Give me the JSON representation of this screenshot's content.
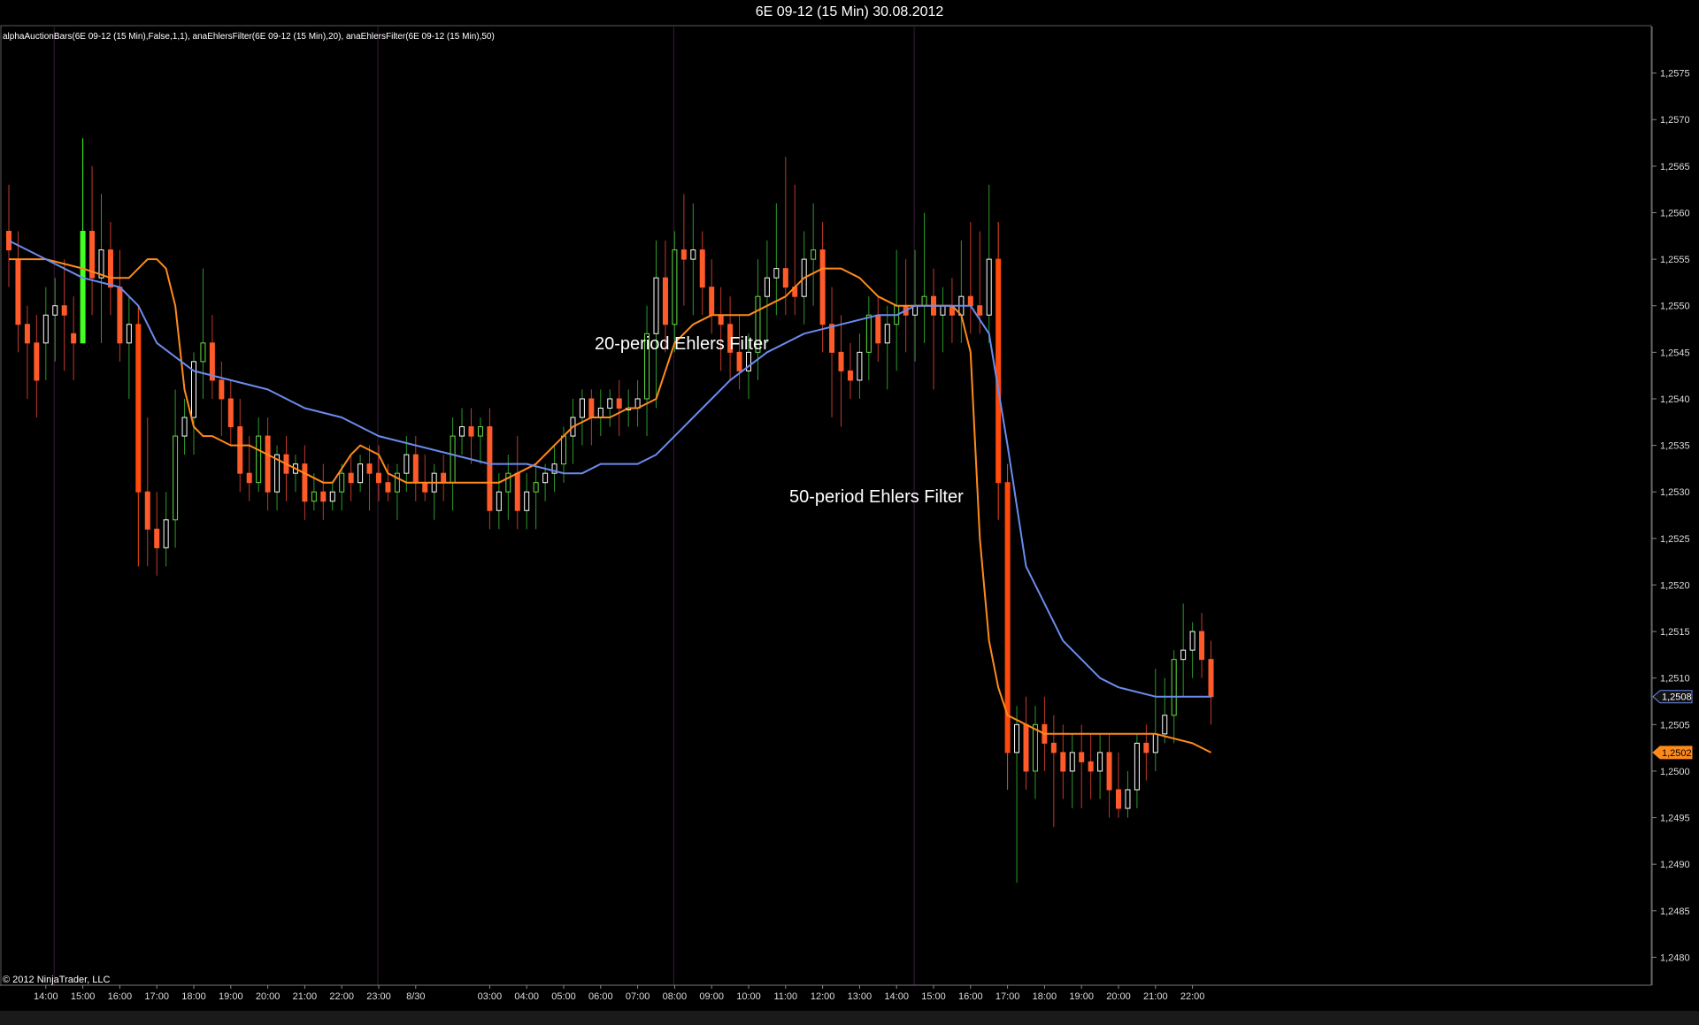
{
  "window": {
    "title": "6E 09-12 (15 Min)  30.08.2012"
  },
  "chart_data": {
    "type": "candlestick",
    "instrument": "6E 09-12 (15 Min)",
    "date": "30.08.2012",
    "indicator_text": "alphaAuctionBars(6E 09-12 (15 Min),False,1,1), anaEhlersFilter(6E 09-12 (15 Min),20), anaEhlersFilter(6E 09-12 (15 Min),50)",
    "copyright": "© 2012 NinjaTrader, LLC",
    "ylim": [
      1.2477,
      1.258
    ],
    "y_ticks": [
      "1,2480",
      "1,2485",
      "1,2490",
      "1,2495",
      "1,2500",
      "1,2505",
      "1,2510",
      "1,2515",
      "1,2520",
      "1,2525",
      "1,2530",
      "1,2535",
      "1,2540",
      "1,2545",
      "1,2550",
      "1,2555",
      "1,2560",
      "1,2565",
      "1,2570",
      "1,2575"
    ],
    "y_tick_values": [
      1.248,
      1.2485,
      1.249,
      1.2495,
      1.25,
      1.2505,
      1.251,
      1.2515,
      1.252,
      1.2525,
      1.253,
      1.2535,
      1.254,
      1.2545,
      1.255,
      1.2555,
      1.256,
      1.2565,
      1.257,
      1.2575
    ],
    "x_labels": [
      {
        "label": "14:00",
        "bar": 4
      },
      {
        "label": "15:00",
        "bar": 8
      },
      {
        "label": "16:00",
        "bar": 12
      },
      {
        "label": "17:00",
        "bar": 16
      },
      {
        "label": "18:00",
        "bar": 20
      },
      {
        "label": "19:00",
        "bar": 24
      },
      {
        "label": "20:00",
        "bar": 28
      },
      {
        "label": "21:00",
        "bar": 32
      },
      {
        "label": "22:00",
        "bar": 36
      },
      {
        "label": "23:00",
        "bar": 40
      },
      {
        "label": "8/30",
        "bar": 44
      },
      {
        "label": "03:00",
        "bar": 52
      },
      {
        "label": "04:00",
        "bar": 56
      },
      {
        "label": "05:00",
        "bar": 60
      },
      {
        "label": "06:00",
        "bar": 64
      },
      {
        "label": "07:00",
        "bar": 68
      },
      {
        "label": "08:00",
        "bar": 72
      },
      {
        "label": "09:00",
        "bar": 76
      },
      {
        "label": "10:00",
        "bar": 80
      },
      {
        "label": "11:00",
        "bar": 84
      },
      {
        "label": "12:00",
        "bar": 88
      },
      {
        "label": "13:00",
        "bar": 92
      },
      {
        "label": "14:00",
        "bar": 96
      },
      {
        "label": "15:00",
        "bar": 100
      },
      {
        "label": "16:00",
        "bar": 104
      },
      {
        "label": "17:00",
        "bar": 108
      },
      {
        "label": "18:00",
        "bar": 112
      },
      {
        "label": "19:00",
        "bar": 116
      },
      {
        "label": "20:00",
        "bar": 120
      },
      {
        "label": "21:00",
        "bar": 124
      },
      {
        "label": "22:00",
        "bar": 128
      }
    ],
    "session_breaks": [
      5,
      40,
      72,
      98
    ],
    "candles_ohlc": [
      [
        1.2558,
        1.2563,
        1.2552,
        1.2556
      ],
      [
        1.2555,
        1.2558,
        1.2545,
        1.2548
      ],
      [
        1.2548,
        1.255,
        1.254,
        1.2546
      ],
      [
        1.2546,
        1.2549,
        1.2538,
        1.2542
      ],
      [
        1.2546,
        1.2552,
        1.2542,
        1.2549
      ],
      [
        1.2549,
        1.2553,
        1.2544,
        1.255
      ],
      [
        1.255,
        1.2555,
        1.2543,
        1.2549
      ],
      [
        1.2547,
        1.2551,
        1.2542,
        1.2546
      ],
      [
        1.2546,
        1.2568,
        1.2546,
        1.2558
      ],
      [
        1.2558,
        1.2565,
        1.2549,
        1.2553
      ],
      [
        1.2553,
        1.2562,
        1.2546,
        1.2556
      ],
      [
        1.2556,
        1.2559,
        1.2549,
        1.2552
      ],
      [
        1.2552,
        1.2556,
        1.2544,
        1.2546
      ],
      [
        1.2546,
        1.2551,
        1.254,
        1.2548
      ],
      [
        1.2548,
        1.255,
        1.2522,
        1.253
      ],
      [
        1.253,
        1.2538,
        1.2522,
        1.2526
      ],
      [
        1.2526,
        1.253,
        1.2521,
        1.2524
      ],
      [
        1.2524,
        1.253,
        1.2522,
        1.2527
      ],
      [
        1.2527,
        1.2541,
        1.2524,
        1.2536
      ],
      [
        1.2536,
        1.254,
        1.2534,
        1.2538
      ],
      [
        1.2538,
        1.2545,
        1.2534,
        1.2544
      ],
      [
        1.2544,
        1.2554,
        1.254,
        1.2546
      ],
      [
        1.2546,
        1.2549,
        1.254,
        1.2542
      ],
      [
        1.2542,
        1.2544,
        1.2536,
        1.254
      ],
      [
        1.254,
        1.2542,
        1.2535,
        1.2537
      ],
      [
        1.2537,
        1.254,
        1.253,
        1.2532
      ],
      [
        1.2532,
        1.2536,
        1.2529,
        1.2531
      ],
      [
        1.2531,
        1.2538,
        1.253,
        1.2536
      ],
      [
        1.2536,
        1.2538,
        1.2528,
        1.253
      ],
      [
        1.253,
        1.2535,
        1.2528,
        1.2534
      ],
      [
        1.2534,
        1.2536,
        1.2529,
        1.2532
      ],
      [
        1.2532,
        1.2534,
        1.253,
        1.2533
      ],
      [
        1.2533,
        1.2535,
        1.2527,
        1.2529
      ],
      [
        1.2529,
        1.2532,
        1.2528,
        1.253
      ],
      [
        1.253,
        1.2533,
        1.2527,
        1.2529
      ],
      [
        1.2529,
        1.2531,
        1.2528,
        1.253
      ],
      [
        1.253,
        1.2533,
        1.2528,
        1.2532
      ],
      [
        1.2532,
        1.2534,
        1.2529,
        1.2531
      ],
      [
        1.2531,
        1.2534,
        1.253,
        1.2533
      ],
      [
        1.2533,
        1.2535,
        1.2528,
        1.2532
      ],
      [
        1.2532,
        1.2535,
        1.2529,
        1.2531
      ],
      [
        1.2531,
        1.2533,
        1.2529,
        1.253
      ],
      [
        1.253,
        1.2533,
        1.2527,
        1.2532
      ],
      [
        1.2532,
        1.2536,
        1.253,
        1.2534
      ],
      [
        1.2534,
        1.2536,
        1.2529,
        1.2531
      ],
      [
        1.2531,
        1.2534,
        1.2529,
        1.253
      ],
      [
        1.253,
        1.2533,
        1.2527,
        1.2532
      ],
      [
        1.2532,
        1.2534,
        1.2529,
        1.2531
      ],
      [
        1.2531,
        1.2538,
        1.2528,
        1.2536
      ],
      [
        1.2536,
        1.2539,
        1.2534,
        1.2537
      ],
      [
        1.2537,
        1.2539,
        1.2533,
        1.2536
      ],
      [
        1.2536,
        1.2538,
        1.2533,
        1.2537
      ],
      [
        1.2537,
        1.2539,
        1.2526,
        1.2528
      ],
      [
        1.2528,
        1.2532,
        1.2526,
        1.253
      ],
      [
        1.253,
        1.2534,
        1.2527,
        1.2532
      ],
      [
        1.2532,
        1.2536,
        1.2526,
        1.2528
      ],
      [
        1.2528,
        1.2532,
        1.2526,
        1.253
      ],
      [
        1.253,
        1.2533,
        1.2526,
        1.2531
      ],
      [
        1.2531,
        1.2533,
        1.2529,
        1.2532
      ],
      [
        1.2532,
        1.2535,
        1.253,
        1.2533
      ],
      [
        1.2533,
        1.2537,
        1.2531,
        1.2536
      ],
      [
        1.2536,
        1.254,
        1.2533,
        1.2538
      ],
      [
        1.2538,
        1.2541,
        1.2535,
        1.254
      ],
      [
        1.254,
        1.2541,
        1.2535,
        1.2538
      ],
      [
        1.2538,
        1.2541,
        1.2536,
        1.2539
      ],
      [
        1.2539,
        1.2541,
        1.2537,
        1.254
      ],
      [
        1.254,
        1.2542,
        1.2536,
        1.2539
      ],
      [
        1.2539,
        1.2541,
        1.2537,
        1.2539
      ],
      [
        1.2539,
        1.2542,
        1.2537,
        1.254
      ],
      [
        1.254,
        1.255,
        1.2536,
        1.2547
      ],
      [
        1.2547,
        1.2557,
        1.2539,
        1.2553
      ],
      [
        1.2553,
        1.2557,
        1.2545,
        1.2548
      ],
      [
        1.2548,
        1.2558,
        1.2545,
        1.2556
      ],
      [
        1.2556,
        1.2562,
        1.255,
        1.2555
      ],
      [
        1.2555,
        1.2561,
        1.2549,
        1.2556
      ],
      [
        1.2556,
        1.2558,
        1.2549,
        1.2552
      ],
      [
        1.2552,
        1.2555,
        1.2547,
        1.2549
      ],
      [
        1.2549,
        1.2552,
        1.2543,
        1.2548
      ],
      [
        1.2548,
        1.2551,
        1.2542,
        1.2545
      ],
      [
        1.2545,
        1.2549,
        1.2541,
        1.2543
      ],
      [
        1.2543,
        1.2547,
        1.254,
        1.2545
      ],
      [
        1.2545,
        1.2555,
        1.2542,
        1.2551
      ],
      [
        1.2551,
        1.2557,
        1.2546,
        1.2553
      ],
      [
        1.2553,
        1.2561,
        1.2549,
        1.2554
      ],
      [
        1.2554,
        1.2566,
        1.2549,
        1.2552
      ],
      [
        1.2552,
        1.2563,
        1.2549,
        1.2551
      ],
      [
        1.2551,
        1.2558,
        1.2548,
        1.2555
      ],
      [
        1.2555,
        1.2561,
        1.255,
        1.2556
      ],
      [
        1.2556,
        1.2559,
        1.2545,
        1.2548
      ],
      [
        1.2548,
        1.2552,
        1.2538,
        1.2545
      ],
      [
        1.2545,
        1.2549,
        1.2537,
        1.2543
      ],
      [
        1.2543,
        1.2546,
        1.254,
        1.2542
      ],
      [
        1.2542,
        1.2547,
        1.254,
        1.2545
      ],
      [
        1.2545,
        1.2551,
        1.2542,
        1.2549
      ],
      [
        1.2549,
        1.2551,
        1.2544,
        1.2546
      ],
      [
        1.2546,
        1.255,
        1.2541,
        1.2548
      ],
      [
        1.2548,
        1.2556,
        1.2543,
        1.255
      ],
      [
        1.255,
        1.2555,
        1.2545,
        1.2549
      ],
      [
        1.2549,
        1.2556,
        1.2544,
        1.255
      ],
      [
        1.255,
        1.256,
        1.2546,
        1.2551
      ],
      [
        1.2551,
        1.2554,
        1.2541,
        1.2549
      ],
      [
        1.2549,
        1.2552,
        1.2545,
        1.255
      ],
      [
        1.255,
        1.2553,
        1.2546,
        1.2549
      ],
      [
        1.2549,
        1.2557,
        1.2546,
        1.2551
      ],
      [
        1.2551,
        1.2559,
        1.2547,
        1.255
      ],
      [
        1.255,
        1.2558,
        1.2547,
        1.2549
      ],
      [
        1.2549,
        1.2563,
        1.2546,
        1.2555
      ],
      [
        1.2555,
        1.2559,
        1.2527,
        1.2531
      ],
      [
        1.2531,
        1.2533,
        1.2498,
        1.2502
      ],
      [
        1.2502,
        1.2507,
        1.2488,
        1.2505
      ],
      [
        1.2505,
        1.2508,
        1.2498,
        1.25
      ],
      [
        1.25,
        1.2507,
        1.2497,
        1.2505
      ],
      [
        1.2505,
        1.2508,
        1.25,
        1.2503
      ],
      [
        1.2503,
        1.2506,
        1.2494,
        1.2502
      ],
      [
        1.2502,
        1.2505,
        1.2497,
        1.25
      ],
      [
        1.25,
        1.2504,
        1.2496,
        1.2502
      ],
      [
        1.2502,
        1.2505,
        1.2496,
        1.2501
      ],
      [
        1.2501,
        1.2504,
        1.2497,
        1.25
      ],
      [
        1.25,
        1.2504,
        1.2497,
        1.2502
      ],
      [
        1.2502,
        1.2504,
        1.2495,
        1.2498
      ],
      [
        1.2498,
        1.2502,
        1.2495,
        1.2496
      ],
      [
        1.2496,
        1.25,
        1.2495,
        1.2498
      ],
      [
        1.2498,
        1.2504,
        1.2496,
        1.2503
      ],
      [
        1.2503,
        1.2505,
        1.2499,
        1.2502
      ],
      [
        1.2502,
        1.2511,
        1.25,
        1.2504
      ],
      [
        1.2504,
        1.251,
        1.2503,
        1.2506
      ],
      [
        1.2506,
        1.2513,
        1.2503,
        1.2512
      ],
      [
        1.2512,
        1.2518,
        1.2508,
        1.2513
      ],
      [
        1.2513,
        1.2516,
        1.251,
        1.2515
      ],
      [
        1.2515,
        1.2517,
        1.251,
        1.2512
      ],
      [
        1.2512,
        1.2514,
        1.2505,
        1.2508
      ]
    ],
    "series": [
      {
        "name": "20-period Ehlers Filter",
        "color": "#ff8a1c",
        "values": [
          1.2555,
          1.2555,
          1.2554,
          1.2553,
          1.2553,
          1.2554,
          1.2555,
          1.2555,
          1.2554,
          1.255,
          1.2541,
          1.2537,
          1.2536,
          1.2536,
          1.2535,
          1.2535,
          1.2534,
          1.2533,
          1.2532,
          1.2531,
          1.2531,
          1.2534,
          1.2535,
          1.2534,
          1.2532,
          1.2531,
          1.2531,
          1.2531,
          1.2531,
          1.2531,
          1.2531,
          1.2532,
          1.2533,
          1.2535,
          1.2537,
          1.2538,
          1.2538,
          1.2539,
          1.2539,
          1.254,
          1.2546,
          1.2548,
          1.2549,
          1.2549,
          1.2549,
          1.255,
          1.2551,
          1.2553,
          1.2554,
          1.2554,
          1.2553,
          1.2551,
          1.255,
          1.255,
          1.255,
          1.255,
          1.2549,
          1.2545,
          1.2525,
          1.2514,
          1.2509,
          1.2506,
          1.2505,
          1.2504,
          1.2504,
          1.2504,
          1.2504,
          1.2503,
          1.2502
        ],
        "bar_index": [
          0,
          4,
          8,
          11,
          13,
          14,
          15,
          16,
          17,
          18,
          19,
          20,
          21,
          22,
          24,
          26,
          28,
          30,
          32,
          34,
          35,
          37,
          38,
          40,
          41,
          43,
          45,
          47,
          49,
          51,
          53,
          55,
          57,
          59,
          61,
          63,
          65,
          67,
          68,
          70,
          72,
          74,
          76,
          78,
          80,
          82,
          84,
          86,
          88,
          90,
          92,
          94,
          96,
          98,
          100,
          102,
          103,
          104,
          105,
          106,
          107,
          108,
          110,
          112,
          114,
          116,
          124,
          128,
          130
        ]
      },
      {
        "name": "50-period Ehlers Filter",
        "color": "#6b8cee",
        "values": [
          1.2557,
          1.2555,
          1.2553,
          1.2552,
          1.255,
          1.2546,
          1.2543,
          1.2542,
          1.2541,
          1.2539,
          1.2538,
          1.2536,
          1.2535,
          1.2534,
          1.2533,
          1.2533,
          1.2532,
          1.2532,
          1.2533,
          1.2533,
          1.2533,
          1.2534,
          1.2536,
          1.2538,
          1.254,
          1.2542,
          1.2545,
          1.2547,
          1.2548,
          1.2549,
          1.2549,
          1.255,
          1.255,
          1.255,
          1.2547,
          1.2535,
          1.2522,
          1.2514,
          1.251,
          1.2509,
          1.2508,
          1.2508
        ],
        "bar_index": [
          0,
          4,
          8,
          12,
          14,
          16,
          20,
          24,
          28,
          32,
          36,
          40,
          44,
          48,
          52,
          56,
          60,
          62,
          64,
          66,
          68,
          70,
          72,
          74,
          76,
          78,
          82,
          86,
          90,
          94,
          96,
          98,
          100,
          104,
          106,
          108,
          110,
          114,
          118,
          120,
          124,
          130
        ]
      }
    ],
    "annotations": [
      "20-period Ehlers Filter",
      "50-period Ehlers Filter"
    ],
    "price_markers": [
      {
        "label": "1,2508",
        "value": 1.2508,
        "color": "#6b8cee"
      },
      {
        "label": "1,2502",
        "value": 1.2502,
        "color": "#ff8a1c"
      }
    ],
    "colors": {
      "background": "#000000",
      "up_body": "#ffffff",
      "down_body": "#ff5a2a",
      "up_wick": "#2a9a2a",
      "down_wick": "#c0392b",
      "strong_up": "#44ff22",
      "strong_down": "#ff4a0a",
      "green_body": "#66dd44"
    }
  }
}
